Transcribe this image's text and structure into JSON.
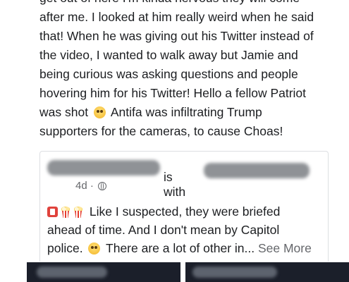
{
  "post": {
    "body_lines": [
      "get out of here I'm kinda nervous they will come",
      "after me. I looked at him really weird when he said",
      "that! When he was giving out his Twitter instead of",
      "the video, I wanted to walk away but Jamie and",
      "being curious was asking questions and people",
      "hovering him for his Twitter! Hello a fellow Patriot",
      "was shot",
      "Antifa was infiltrating Trump",
      "supporters for the cameras, to cause Choas!"
    ],
    "flushed_emoji": "flushed-face-emoji"
  },
  "shared_post": {
    "with_text": "is with",
    "timestamp": "4d ·",
    "privacy_icon": "globe-icon",
    "text_line1": "Like I suspected, they were briefed",
    "text_line2": "ahead of time. And I don't mean by Capitol",
    "text_line3_start": "police.",
    "text_line3_end": "There are a lot of other in...",
    "see_more": "See More",
    "icons": [
      "red-box-icon",
      "popcorn-icon",
      "popcorn-icon",
      "relieved-face-emoji"
    ]
  },
  "colors": {
    "text": "#1c1e21",
    "meta": "#65676b",
    "card_border": "#dddfe2",
    "bottom_bar": "#1b1f2a",
    "redaction": "#8f9296"
  }
}
